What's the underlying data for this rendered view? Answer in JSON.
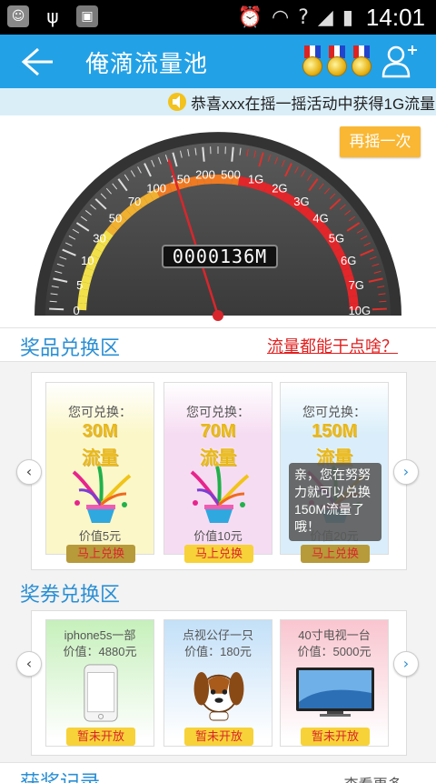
{
  "status_bar": {
    "time": "14:01"
  },
  "header": {
    "title": "俺滴流量池",
    "medal_count": 3
  },
  "marquee": {
    "text": "恭喜xxx在摇一摇活动中获得1G流量"
  },
  "gauge": {
    "reading": "0000136M",
    "shake_label": "再摇一次",
    "scale_labels": [
      "0",
      "5",
      "10",
      "30",
      "50",
      "70",
      "100",
      "150",
      "200",
      "500",
      "1G",
      "2G",
      "3G",
      "4G",
      "5G",
      "6G",
      "7G",
      "10G"
    ],
    "needle_position_fraction": 0.4
  },
  "prize_section": {
    "title": "奖品兑换区",
    "link": "流量都能干点啥？",
    "cards": [
      {
        "label": "您可兑换：",
        "amount": "30M",
        "unit": "流量",
        "price": "价值5元",
        "button": "马上兑换",
        "bg": "#fbf7c8",
        "button_color": "#b79a3a"
      },
      {
        "label": "您可兑换：",
        "amount": "70M",
        "unit": "流量",
        "price": "价值10元",
        "button": "马上兑换",
        "bg": "#f6dcf2",
        "button_color": "#f7d238"
      },
      {
        "label": "您可兑换：",
        "amount": "150M",
        "unit": "流量",
        "price": "价值20元",
        "button": "马上兑换",
        "bg": "#d9eefa",
        "button_color": "#b79a3a"
      }
    ],
    "tooltip": "亲，您在努努力就可以兑换150M流量了哦！"
  },
  "voucher_section": {
    "title": "奖券兑换区",
    "cards": [
      {
        "title": "iphone5s一部",
        "value": "价值：4880元",
        "button": "暂未开放",
        "bg": "#c6f0bb"
      },
      {
        "title": "点视公仔一只",
        "value": "价值：180元",
        "button": "暂未开放",
        "bg": "#c3e0f8"
      },
      {
        "title": "40寸电视一台",
        "value": "价值：5000元",
        "button": "暂未开放",
        "bg": "#f9c5cf"
      }
    ]
  },
  "records_section": {
    "title": "获奖记录",
    "more": "查看更多..."
  },
  "colors": {
    "primary": "#23a1e6",
    "accent": "#f9b733",
    "link_red": "#e02020"
  }
}
